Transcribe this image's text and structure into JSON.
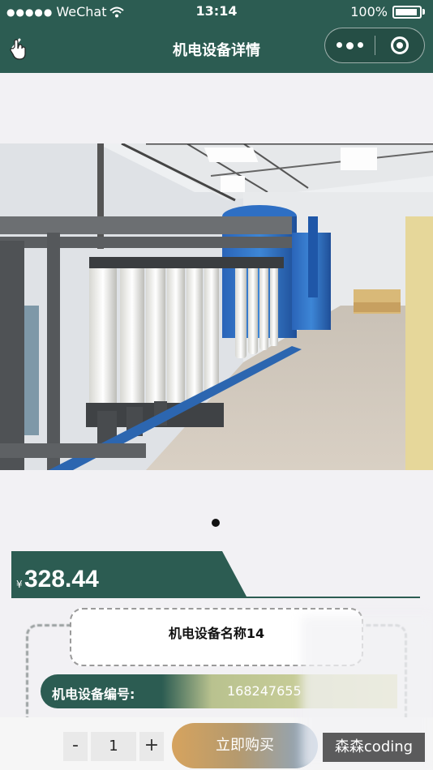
{
  "status_bar": {
    "signal": "●●●●●",
    "carrier": "WeChat",
    "time": "13:14",
    "battery": "100%"
  },
  "nav": {
    "title": "机电设备详情"
  },
  "product": {
    "currency": "¥",
    "price": "328.44",
    "name": "机电设备名称14",
    "code_label": "机电设备编号:",
    "code_value": "168247655"
  },
  "banner": {
    "slide_count": 1,
    "active_index": 0
  },
  "cart": {
    "minus_label": "-",
    "quantity": "1",
    "plus_label": "+",
    "buy_label": "立即购买"
  },
  "watermark": "森森coding",
  "colors": {
    "primary": "#2c5c52",
    "buy_gradient_start": "#d6a35e",
    "buy_gradient_end": "#8aa7c7"
  }
}
